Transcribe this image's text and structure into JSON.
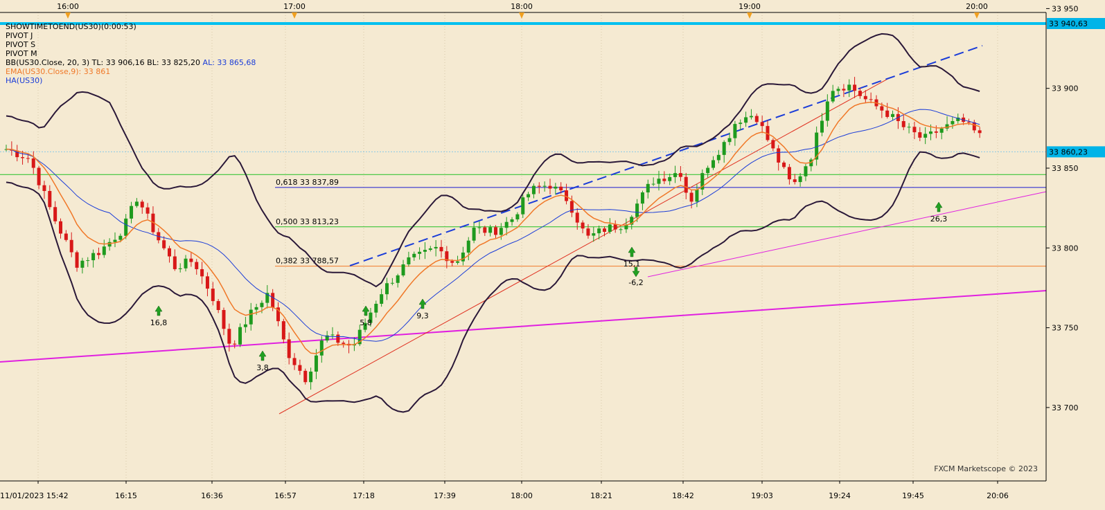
{
  "chart_data": {
    "type": "candlestick",
    "symbol": "US30",
    "ylim": [
      33677,
      33962
    ],
    "y_ticks": [
      33700,
      33750,
      33800,
      33850,
      33900,
      33950
    ],
    "y_tick_labels": [
      "33 700",
      "33 750",
      "33 800",
      "33 850",
      "33 900",
      "33 950"
    ],
    "top_time_labels": [
      "16:00",
      "17:00",
      "18:00",
      "19:00",
      "20:00"
    ],
    "bottom_time_labels": [
      "11/01/2023 15:42",
      "16:15",
      "16:36",
      "16:57",
      "17:18",
      "17:39",
      "18:00",
      "18:21",
      "18:42",
      "19:03",
      "19:24",
      "19:45",
      "20:06"
    ],
    "legend": [
      {
        "text": "SHOWTIMETOEND(US30)(0:00:53)",
        "color": "#000000"
      },
      {
        "text": "PIVOT J",
        "color": "#000000"
      },
      {
        "text": "PIVOT S",
        "color": "#000000"
      },
      {
        "text": "PIVOT M",
        "color": "#000000"
      },
      {
        "parts": [
          {
            "text": "BB(US30.Close, 20, 3)  TL: 33 906,16  BL: 33 825,20  ",
            "color": "#000000"
          },
          {
            "text": "AL: 33 865,68",
            "color": "#1a3cd8"
          }
        ]
      },
      {
        "text": "EMA(US30.Close,9): 33 861",
        "color": "#f07828"
      },
      {
        "text": "HA(US30)",
        "color": "#1a3cd8"
      }
    ],
    "price_labels": [
      {
        "text": "33 940,63",
        "value": 33940.63,
        "background": "#00b4e8"
      },
      {
        "text": "33 860,23",
        "value": 33860.23,
        "background": "#00b4e8"
      }
    ],
    "fib_levels": [
      {
        "label": "0,618 33 837,89",
        "value": 33837.89,
        "color": "#1a1ad0"
      },
      {
        "label": "0,500 33 813,23",
        "value": 33813.23,
        "color": "#22c022"
      },
      {
        "label": "0,382 33 788,57",
        "value": 33788.57,
        "color": "#f07828"
      }
    ],
    "pivot_line": {
      "value": 33846,
      "color": "#22c022"
    },
    "last_price_line": {
      "value": 33860.23,
      "color": "#88c8e8"
    },
    "resistance_line": {
      "value": 33940.63,
      "color": "#00c0f0"
    },
    "candles_ohlc": [],
    "signals": [
      {
        "label": "16,8",
        "dir": "up"
      },
      {
        "label": "3,8",
        "dir": "up"
      },
      {
        "label": "5,8",
        "dir": "up"
      },
      {
        "label": "9,3",
        "dir": "up"
      },
      {
        "label": "15,1",
        "dir": "up"
      },
      {
        "label": "-6,2",
        "dir": "down"
      },
      {
        "label": "26,3",
        "dir": "up"
      }
    ],
    "watermark": "FXCM Marketscope © 2023",
    "colors": {
      "background": "#f5ead2",
      "bull": "#1e9a1e",
      "bear": "#d81818",
      "bollinger": "#2a1838",
      "ema": "#f07828",
      "ha": "#1a3cd8",
      "trend": "#e020e0"
    }
  }
}
